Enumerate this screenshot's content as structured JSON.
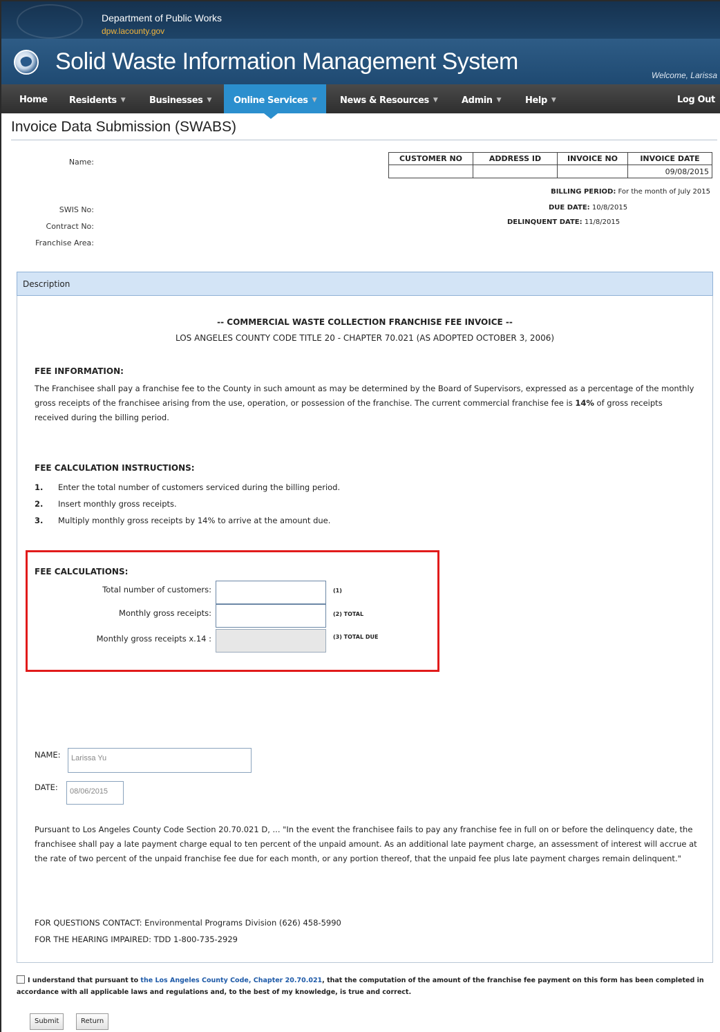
{
  "header": {
    "dept_name": "Department of Public Works",
    "dept_url": "dpw.lacounty.gov",
    "system_title": "Solid Waste Information Management System",
    "welcome": "Welcome, Larissa"
  },
  "nav": {
    "home": "Home",
    "residents": "Residents",
    "businesses": "Businesses",
    "online_services": "Online Services",
    "news_resources": "News & Resources",
    "admin": "Admin",
    "help": "Help",
    "logout": "Log Out",
    "active": "Online Services"
  },
  "page_title": "Invoice Data Submission (SWABS)",
  "customer": {
    "name_label": "Name:",
    "swis_label": "SWIS No:",
    "contract_label": "Contract No:",
    "franchise_label": "Franchise Area:"
  },
  "invoice_table": {
    "headers": [
      "CUSTOMER NO",
      "ADDRESS ID",
      "INVOICE NO",
      "INVOICE DATE"
    ],
    "row": [
      "",
      "",
      "",
      "09/08/2015"
    ]
  },
  "billing": {
    "period_label": "BILLING PERIOD:",
    "period_value": "For the month of July 2015",
    "due_label": "DUE DATE:",
    "due_value": "10/8/2015",
    "delinquent_label": "DELINQUENT DATE:",
    "delinquent_value": "11/8/2015"
  },
  "description_header": "Description",
  "invoice_title": "-- COMMERCIAL WASTE COLLECTION FRANCHISE FEE INVOICE --",
  "invoice_subtitle": "LOS ANGELES COUNTY CODE TITLE 20 - CHAPTER 70.021 (AS ADOPTED OCTOBER 3, 2006)",
  "fee_info": {
    "heading": "FEE INFORMATION:",
    "text_before": "The Franchisee shall pay a franchise fee to the County in such amount as may be determined by the Board of Supervisors, expressed as a percentage of the monthly gross receipts of the franchisee arising from the use, operation, or possession of the franchise. The current commercial franchise fee is ",
    "rate": "14%",
    "text_after": " of gross receipts received during the billing period."
  },
  "instructions": {
    "heading": "FEE CALCULATION INSTRUCTIONS:",
    "steps": [
      {
        "num": "1.",
        "text": "Enter the total number of customers serviced during the billing period."
      },
      {
        "num": "2.",
        "text": "Insert monthly gross receipts."
      },
      {
        "num": "3.",
        "text": "Multiply monthly gross receipts by 14% to arrive at the amount due."
      }
    ]
  },
  "calculations": {
    "heading": "FEE CALCULATIONS:",
    "customers_label": "Total number of customers:",
    "customers_tag": "(1)",
    "customers_value": "",
    "receipts_label": "Monthly gross receipts:",
    "receipts_tag": "(2) TOTAL",
    "receipts_value": "",
    "due_label": "Monthly gross receipts x.14 :",
    "due_tag": "(3) TOTAL DUE",
    "due_value": ""
  },
  "signature": {
    "name_label": "NAME:",
    "name_value": "Larissa Yu",
    "date_label": "DATE:",
    "date_value": "08/06/2015"
  },
  "late_notice": "Pursuant to Los Angeles County Code Section 20.70.021 D, ... \"In the event the franchisee fails to pay any franchise fee in full on or before the delinquency date, the franchisee shall pay a late payment charge equal to ten percent of the unpaid amount. As an additional late payment charge, an assessment of interest will accrue at the rate of two percent of the unpaid franchise fee due for each month, or any portion thereof, that the unpaid fee plus late payment charges remain delinquent.\"",
  "contacts": {
    "questions": "FOR QUESTIONS CONTACT: Environmental Programs Division (626) 458-5990",
    "hearing": "FOR THE HEARING IMPAIRED: TDD 1-800-735-2929"
  },
  "agreement": {
    "before": "I understand that pursuant to ",
    "link": "the Los Angeles County Code, Chapter 20.70.021",
    "after": ", that the computation of the amount of the franchise fee payment on this form has been completed in accordance with all applicable laws and regulations and, to the best of my knowledge, is true and correct."
  },
  "buttons": {
    "submit": "Submit",
    "return": "Return"
  },
  "colors": {
    "nav_active": "#2b8fce",
    "header_blue": "#1f4a72",
    "highlight_box": "#e11b1b",
    "section_header": "#d3e4f6"
  }
}
